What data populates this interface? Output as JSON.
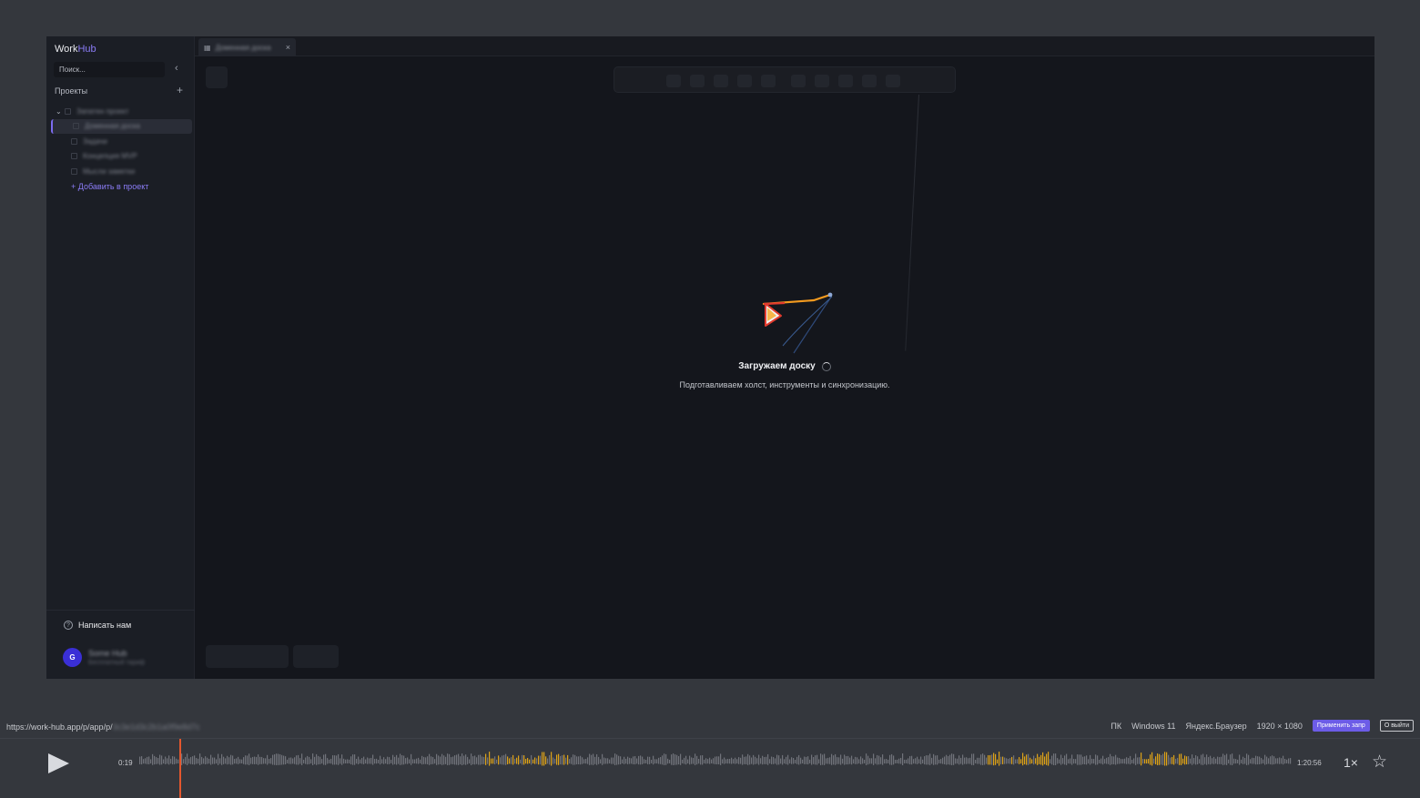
{
  "app": {
    "logo_prefix": "Work",
    "logo_accent": "Hub",
    "search_placeholder": "Поиск...",
    "collapse_icon": "‹",
    "projects_title": "Проекты",
    "add_icon": "+",
    "tree": {
      "project": "Запатен проект",
      "items": [
        "Доменная доска",
        "Задачи",
        "Концепция MVP",
        "Мысли заметки"
      ],
      "add_label": "+ Добавить в проект"
    },
    "help_label": "Написать нам",
    "user": {
      "initial": "G",
      "name": "Some Hub",
      "role": "Бесплатный тариф"
    },
    "tab_label": "Доменная доска",
    "tab_close": "×",
    "loader": {
      "title": "Загружаем доску",
      "subtitle": "Подготавливаем холст, инструменты и синхронизацию."
    }
  },
  "player": {
    "url_visible": "https://work-hub.app/p/app/p/",
    "url_hidden": "3c3e1d3c2b1a0f9e8d7c",
    "device": "ПК",
    "os": "Windows 11",
    "browser": "Яндекс.Браузер",
    "resolution": "1920 × 1080",
    "badge": "Применить запр",
    "exit": "О выйти",
    "time_current": "0:19",
    "time_total": "1:20:56",
    "speed": "1×",
    "star_icon": "☆",
    "progress_fraction": 0.0039
  },
  "colors": {
    "accent": "#8b7cf6",
    "playhead": "#e4572e",
    "wave_active": "#e6a817",
    "wave": "#a3a6ad"
  }
}
